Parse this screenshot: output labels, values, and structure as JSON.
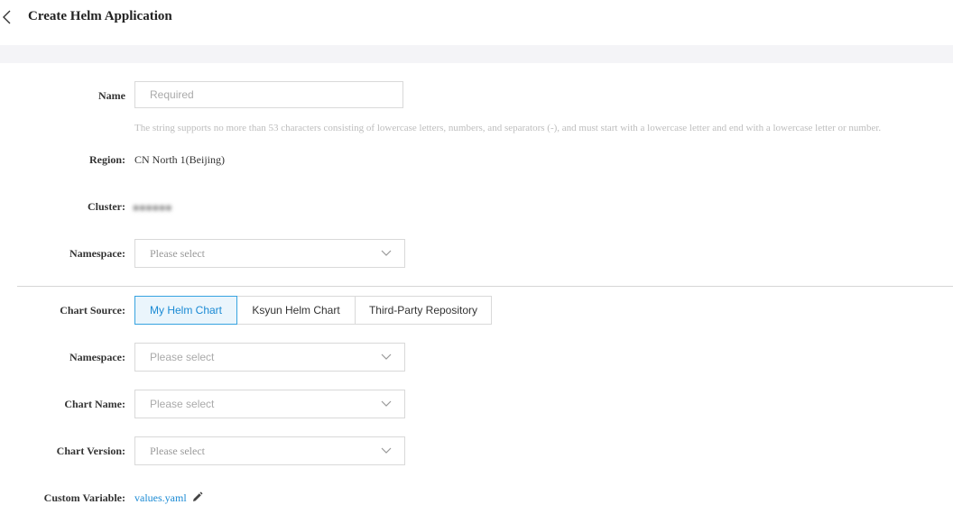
{
  "header": {
    "title": "Create Helm Application"
  },
  "form": {
    "name": {
      "label": "Name",
      "placeholder": "Required",
      "value": ""
    },
    "hint": "The string supports no more than 53 characters consisting of lowercase letters, numbers, and separators (-), and must start with a lowercase letter and end with a lowercase letter or number.",
    "region": {
      "label": "Region:",
      "value": "CN North 1(Beijing)"
    },
    "cluster": {
      "label": "Cluster:",
      "value": "obscured"
    },
    "namespace": {
      "label": "Namespace:",
      "placeholder": "Please select"
    },
    "chart_source": {
      "label": "Chart Source:",
      "options": [
        "My Helm Chart",
        "Ksyun Helm Chart",
        "Third-Party Repository"
      ],
      "selected": "My Helm Chart"
    },
    "chart_namespace": {
      "label": "Namespace:",
      "placeholder": "Please select"
    },
    "chart_name": {
      "label": "Chart Name:",
      "placeholder": "Please select"
    },
    "chart_version": {
      "label": "Chart Version:",
      "placeholder": "Please select"
    },
    "custom_variable": {
      "label": "Custom Variable:",
      "link": "values.yaml"
    }
  },
  "icons": {
    "back": "chevron-left-icon",
    "dropdown": "chevron-down-icon",
    "edit": "pencil-icon"
  },
  "colors": {
    "accent": "#1a8ad4",
    "active_border": "#36a3e0",
    "active_bg": "#eaf5fc"
  }
}
